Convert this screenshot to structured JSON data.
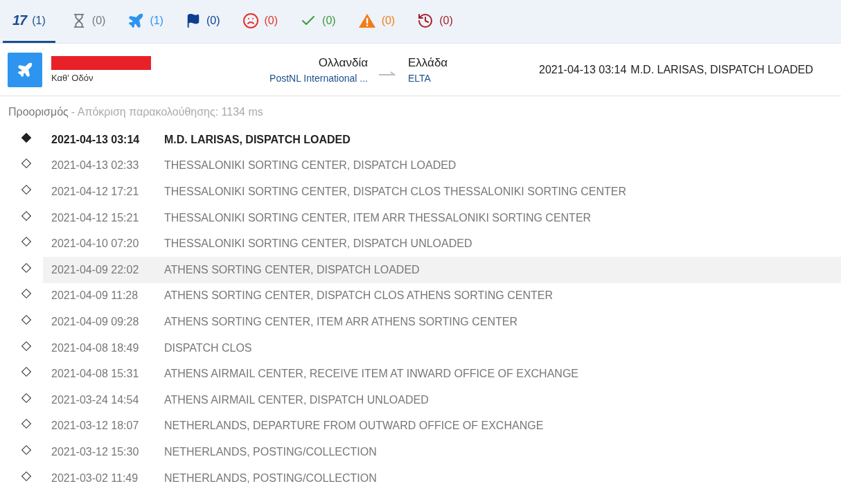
{
  "tabs": [
    {
      "kind": "logo",
      "logo_text": "17",
      "count": "(1)",
      "color": "#1a4f8b",
      "selected": true
    },
    {
      "kind": "hourglass",
      "count": "(0)",
      "color": "#777777",
      "selected": false
    },
    {
      "kind": "plane",
      "count": "(1)",
      "color": "#2d95f0",
      "selected": false
    },
    {
      "kind": "flag",
      "count": "(0)",
      "color": "#0d3f8f",
      "selected": false
    },
    {
      "kind": "frown",
      "count": "(0)",
      "color": "#e0352b",
      "selected": false
    },
    {
      "kind": "check",
      "count": "(0)",
      "color": "#3a9a3a",
      "selected": false
    },
    {
      "kind": "warning",
      "count": "(0)",
      "color": "#f07d18",
      "selected": false
    },
    {
      "kind": "history",
      "count": "(0)",
      "color": "#a3212a",
      "selected": false
    }
  ],
  "shipment": {
    "status": "Καθ' Οδόν",
    "redacted": true,
    "origin": {
      "country": "Ολλανδία",
      "carrier": "PostNL International ..."
    },
    "destination": {
      "country": "Ελλάδα",
      "carrier": "ELTA"
    },
    "latest_time": "2021-04-13 03:14",
    "latest_event": "M.D. LARISAS, DISPATCH LOADED"
  },
  "source": {
    "label": "Προορισμός",
    "response": "- Απόκριση παρακολούθησης: 1134 ms"
  },
  "events": [
    {
      "time": "2021-04-13 03:14",
      "description": "M.D. LARISAS, DISPATCH LOADED",
      "latest": true,
      "highlighted": false
    },
    {
      "time": "2021-04-13 02:33",
      "description": "THESSALONIKI SORTING CENTER, DISPATCH LOADED",
      "latest": false,
      "highlighted": false
    },
    {
      "time": "2021-04-12 17:21",
      "description": "THESSALONIKI SORTING CENTER, DISPATCH CLOS THESSALONIKI SORTING CENTER",
      "latest": false,
      "highlighted": false
    },
    {
      "time": "2021-04-12 15:21",
      "description": "THESSALONIKI SORTING CENTER, ITEM ARR THESSALONIKI SORTING CENTER",
      "latest": false,
      "highlighted": false
    },
    {
      "time": "2021-04-10 07:20",
      "description": "THESSALONIKI SORTING CENTER, DISPATCH UNLOADED",
      "latest": false,
      "highlighted": false
    },
    {
      "time": "2021-04-09 22:02",
      "description": "ATHENS SORTING CENTER, DISPATCH LOADED",
      "latest": false,
      "highlighted": true
    },
    {
      "time": "2021-04-09 11:28",
      "description": "ATHENS SORTING CENTER, DISPATCH CLOS ATHENS SORTING CENTER",
      "latest": false,
      "highlighted": false
    },
    {
      "time": "2021-04-09 09:28",
      "description": "ATHENS SORTING CENTER, ITEM ARR ATHENS SORTING CENTER",
      "latest": false,
      "highlighted": false
    },
    {
      "time": "2021-04-08 18:49",
      "description": "DISPATCH CLOS",
      "latest": false,
      "highlighted": false
    },
    {
      "time": "2021-04-08 15:31",
      "description": "ATHENS AIRMAIL CENTER, RECEIVE ITEM AT INWARD OFFICE OF EXCHANGE",
      "latest": false,
      "highlighted": false
    },
    {
      "time": "2021-03-24 14:54",
      "description": "ATHENS AIRMAIL CENTER, DISPATCH UNLOADED",
      "latest": false,
      "highlighted": false
    },
    {
      "time": "2021-03-12 18:07",
      "description": "NETHERLANDS, DEPARTURE FROM OUTWARD OFFICE OF EXCHANGE",
      "latest": false,
      "highlighted": false
    },
    {
      "time": "2021-03-12 15:30",
      "description": "NETHERLANDS, POSTING/COLLECTION",
      "latest": false,
      "highlighted": false
    },
    {
      "time": "2021-03-02 11:49",
      "description": "NETHERLANDS, POSTING/COLLECTION",
      "latest": false,
      "highlighted": false
    }
  ]
}
